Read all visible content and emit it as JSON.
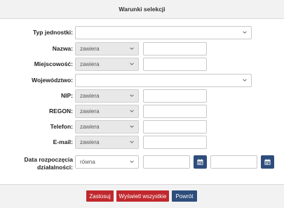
{
  "header": {
    "title": "Warunki selekcji"
  },
  "fields": {
    "typ": {
      "label": "Typ jednostki:",
      "value": ""
    },
    "nazwa": {
      "label": "Nazwa:",
      "operator": "zawiera",
      "value": ""
    },
    "miejscowosc": {
      "label": "Miejscowość:",
      "operator": "zawiera",
      "value": ""
    },
    "wojewodztwo": {
      "label": "Województwo:",
      "value": ""
    },
    "nip": {
      "label": "NIP:",
      "operator": "zawiera",
      "value": ""
    },
    "regon": {
      "label": "REGON:",
      "operator": "zawiera",
      "value": ""
    },
    "telefon": {
      "label": "Telefon:",
      "operator": "zawiera",
      "value": ""
    },
    "email": {
      "label": "E-mail:",
      "operator": "zawiera",
      "value": ""
    },
    "data": {
      "label_line1": "Data rozpoczęcia",
      "label_line2": "działalności:",
      "operator": "równa",
      "from": "",
      "to": ""
    }
  },
  "buttons": {
    "apply": "Zastosuj",
    "show_all": "Wyświetl wszystkie",
    "back": "Powrót"
  },
  "icons": {
    "dropdown": "chevron-down-icon",
    "calendar": "calendar-icon"
  },
  "colors": {
    "red_button": "#c0282d",
    "blue_button": "#2d4d7c"
  }
}
